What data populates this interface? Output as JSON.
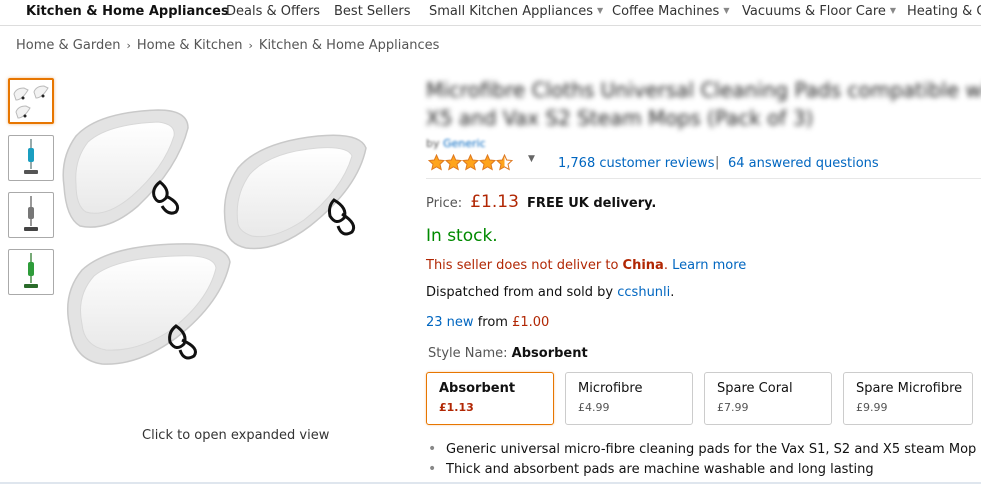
{
  "nav": {
    "items": [
      {
        "label": "Kitchen & Home Appliances",
        "has_caret": false
      },
      {
        "label": "Deals & Offers",
        "has_caret": false
      },
      {
        "label": "Best Sellers",
        "has_caret": false
      },
      {
        "label": "Small Kitchen Appliances",
        "has_caret": true
      },
      {
        "label": "Coffee Machines",
        "has_caret": true
      },
      {
        "label": "Vacuums & Floor Care",
        "has_caret": true
      },
      {
        "label": "Heating & Co",
        "has_caret": false
      }
    ]
  },
  "breadcrumb": [
    "Home & Garden",
    "Home & Kitchen",
    "Kitchen & Home Appliances"
  ],
  "gallery": {
    "thumbnail_icons": [
      "cleaning-pads-thumb-icon",
      "steam-mop-blue-thumb-icon",
      "steam-mop-grey-thumb-icon",
      "steam-mop-green-thumb-icon"
    ],
    "expand_hint": "Click to open expanded view"
  },
  "product": {
    "title_line1": "Microfibre Cloths Universal Cleaning Pads compatible with",
    "title_line2": "X5 and Vax S2 Steam Mops (Pack of 3)",
    "by_label": "by",
    "brand": "Generic",
    "rating": 4.5,
    "reviews": "1,768 customer reviews",
    "questions": "64 answered questions",
    "separator": "|"
  },
  "offer": {
    "price_label": "Price:",
    "price": "£1.13",
    "delivery": "FREE UK delivery.",
    "stock": "In stock.",
    "no_delivery_prefix": "This seller does not deliver to",
    "no_delivery_country": "China",
    "no_delivery_suffix": ".",
    "learn_more": "Learn more",
    "dispatched_prefix": "Dispatched from and sold by",
    "seller": "ccshunli",
    "dispatched_suffix": ".",
    "new_count": "23 new",
    "new_from": "from",
    "new_price": "£1.00"
  },
  "style": {
    "label": "Style Name:",
    "selected": "Absorbent",
    "options": [
      {
        "name": "Absorbent",
        "price": "£1.13"
      },
      {
        "name": "Microfibre",
        "price": "£4.99"
      },
      {
        "name": "Spare Coral",
        "price": "£7.99"
      },
      {
        "name": "Spare Microfibre",
        "price": "£9.99"
      }
    ]
  },
  "bullets": [
    "Generic universal micro-fibre cleaning pads for the Vax S1, S2 and X5 steam Mop",
    "Thick and absorbent pads are machine washable and long lasting"
  ],
  "colors": {
    "link": "#0066c0",
    "price": "#b12704",
    "in_stock": "#008a00",
    "selected_border": "#e77600",
    "star": "#ffa41c"
  }
}
